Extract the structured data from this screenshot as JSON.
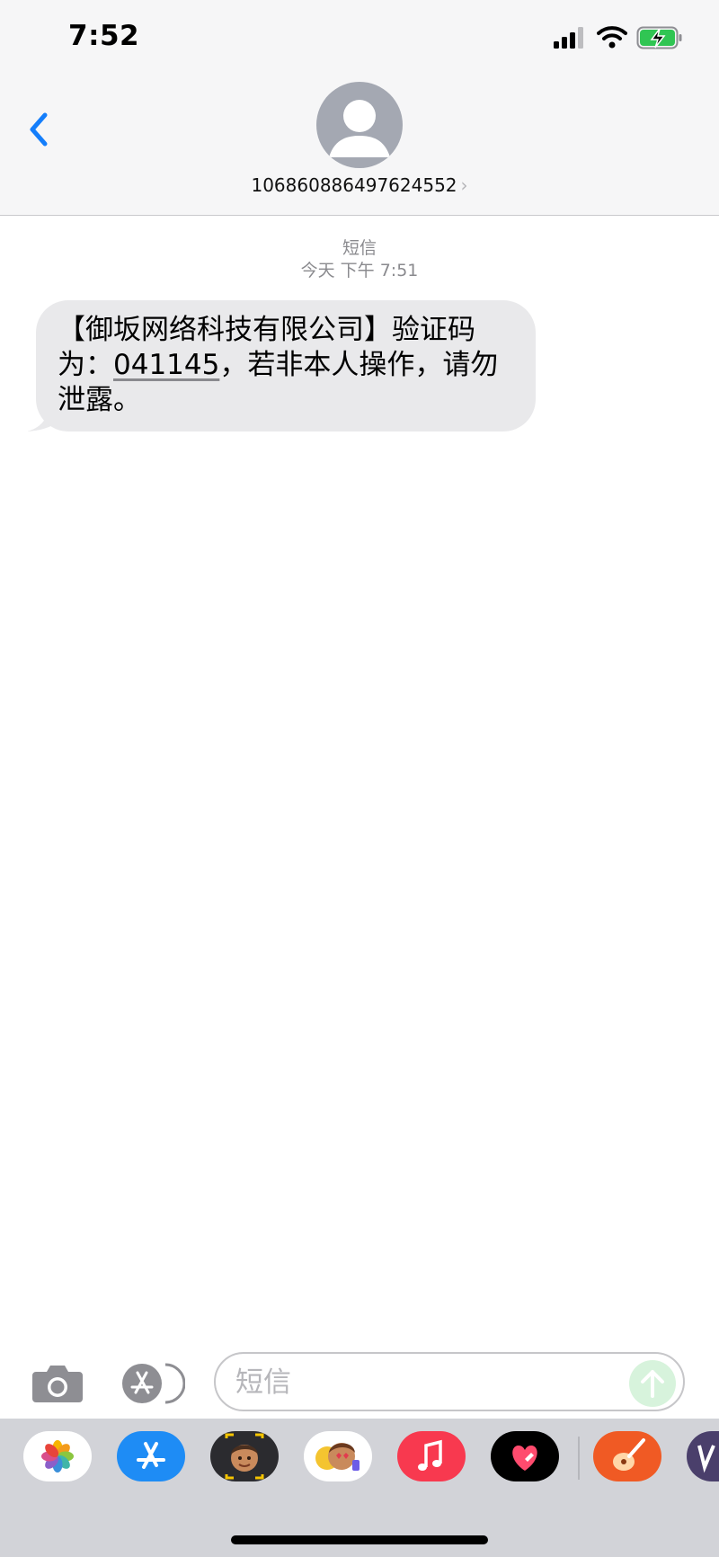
{
  "status_bar": {
    "time": "7:52"
  },
  "header": {
    "contact": "106860886497624552",
    "chevron": "›"
  },
  "conversation": {
    "service_label": "短信",
    "timestamp": "今天 下午 7:51",
    "message": {
      "line1": "【御坂网络科技有限公司】验证码",
      "line2_prefix": "为：",
      "code": "041145",
      "line2_suffix": "，若非本人操作，请勿",
      "line3": "泄露。"
    }
  },
  "input_bar": {
    "placeholder": "短信"
  },
  "app_drawer": {
    "apps": [
      "photos-icon",
      "app-store-icon",
      "memoji-icon",
      "animoji-stickers-icon",
      "music-icon",
      "digital-touch-icon",
      "garageband-icon",
      "partial-app-icon"
    ]
  },
  "colors": {
    "accent_blue": "#147efb",
    "bubble_gray": "#e9e9eb",
    "header_bg": "#f6f6f7",
    "send_green": "#d7f3dc"
  }
}
